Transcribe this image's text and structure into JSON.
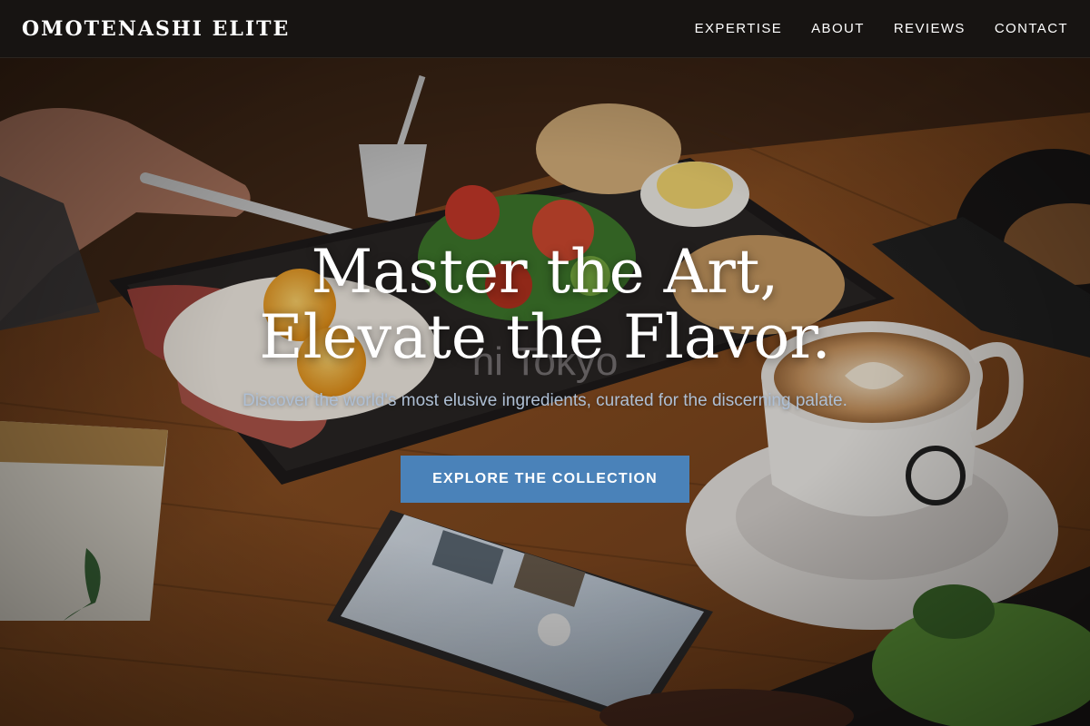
{
  "header": {
    "brand": "OMOTENASHI ELITE",
    "nav": [
      {
        "label": "EXPERTISE"
      },
      {
        "label": "ABOUT"
      },
      {
        "label": "REVIEWS"
      },
      {
        "label": "CONTACT"
      }
    ]
  },
  "hero": {
    "title_line1": "Master the Art,",
    "title_line2": "Elevate the Flavor.",
    "watermark": "ni Tokyo",
    "subtitle": "Discover the world's most elusive ingredients, curated for the discerning palate.",
    "cta_label": "EXPLORE THE COLLECTION",
    "background_image": "breakfast-table-photo"
  },
  "colors": {
    "header_bg": "#171412",
    "cta_bg": "#4a82b9",
    "subtitle": "#aebfd4"
  }
}
